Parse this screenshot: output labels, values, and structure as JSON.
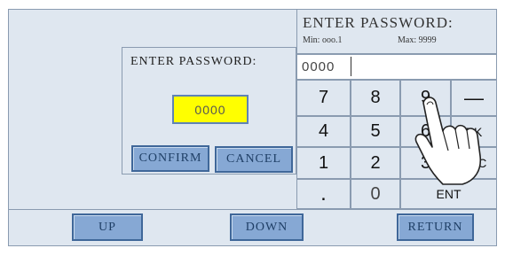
{
  "dialog": {
    "title": "ENTER PASSWORD:",
    "password_value": "0000",
    "confirm_label": "CONFIRM",
    "cancel_label": "CANCEL"
  },
  "keypad": {
    "title": "ENTER PASSWORD:",
    "min_text": "Min: ooo.1",
    "max_text": "Max: 9999",
    "entry_value": "0000",
    "keys": {
      "k7": "7",
      "k8": "8",
      "k9": "9",
      "minus": "—",
      "k4": "4",
      "k5": "5",
      "k6": "6",
      "bk": "BK",
      "k1": "1",
      "k2": "2",
      "k3": "3",
      "esc": "ESC",
      "dot": ".",
      "k0": "0",
      "ent": "ENT"
    }
  },
  "bottom": {
    "up_label": "UP",
    "down_label": "DOWN",
    "return_label": "RETURN"
  },
  "colors": {
    "panel_bg": "#dfe7f0",
    "button_bg": "#86a8d4",
    "password_bg": "#ffff00"
  }
}
